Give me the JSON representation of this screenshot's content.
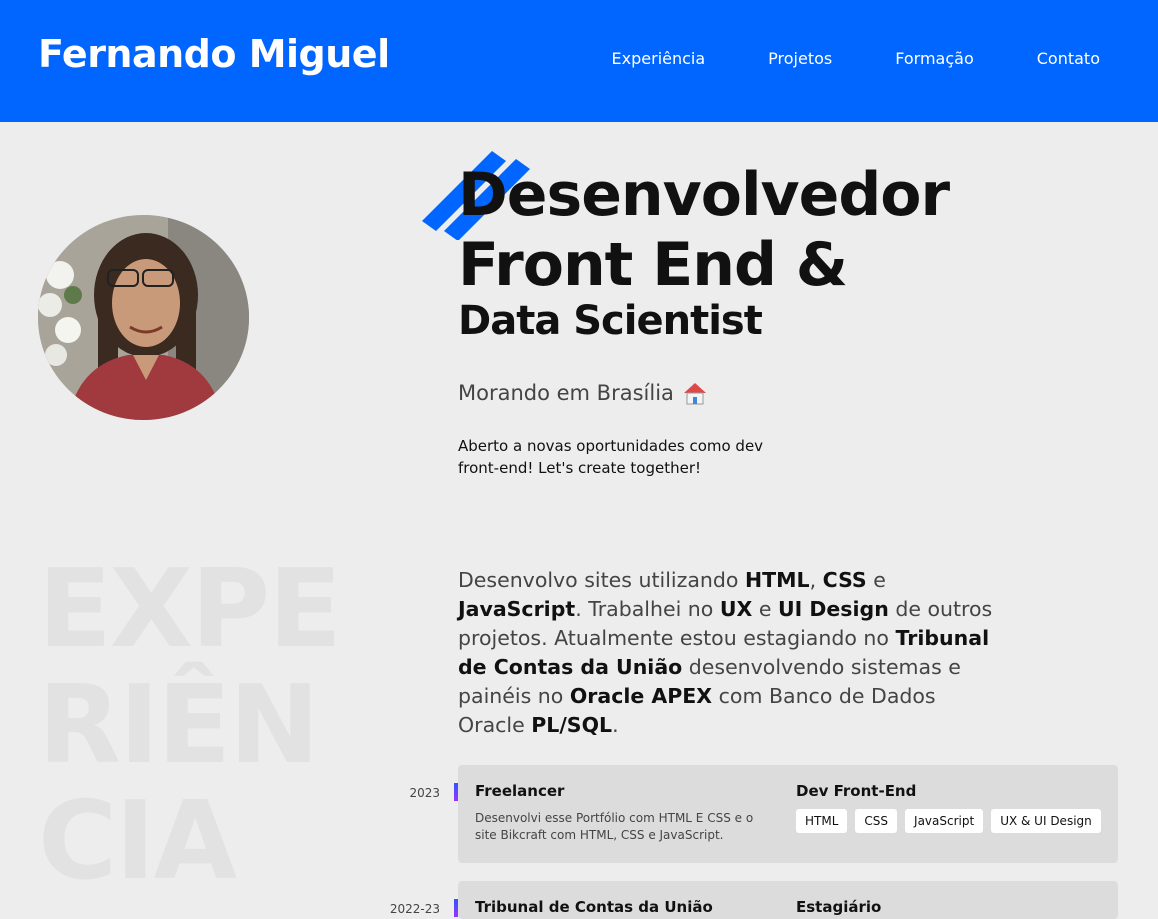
{
  "header": {
    "logo": "Fernando Miguel",
    "nav": [
      "Experiência",
      "Projetos",
      "Formação",
      "Contato"
    ]
  },
  "hero": {
    "title_line1": "Desenvolvedor",
    "title_line2": "Front End &",
    "title_line3": "Data Scientist",
    "location": "Morando em Brasília",
    "open_text": "Aberto a novas oportunidades como dev front-end! Let's create together!"
  },
  "experience": {
    "bg_line1": "EXPE",
    "bg_line2": "RIÊN",
    "bg_line3": "CIA",
    "about_parts": {
      "p1": "Desenvolvo sites utilizando ",
      "b1": "HTML",
      "p2": ", ",
      "b2": "CSS",
      "p3": " e ",
      "b3": "JavaScript",
      "p4": ". Trabalhei no ",
      "b4": "UX",
      "p5": " e ",
      "b5": "UI Design",
      "p6": " de outros projetos. Atualmente estou estagiando no ",
      "b6": "Tribunal de Contas da União",
      "p7": " desenvolvendo sistemas e painéis no ",
      "b7": "Oracle APEX",
      "p8": " com Banco de Dados Oracle ",
      "b8": "PL/SQL",
      "p9": "."
    },
    "items": [
      {
        "year": "2023",
        "company": "Freelancer",
        "description": "Desenvolvi esse Portfólio com HTML E CSS e o site Bikcraft com HTML, CSS e JavaScript.",
        "role": "Dev Front-End",
        "tags": [
          "HTML",
          "CSS",
          "JavaScript",
          "UX & UI Design"
        ]
      },
      {
        "year": "2022-23",
        "company": "Tribunal de Contas da União",
        "role": "Estagiário"
      }
    ]
  },
  "colors": {
    "accent": "#0066ff",
    "background": "#ededed",
    "card": "#dcdcdc"
  }
}
